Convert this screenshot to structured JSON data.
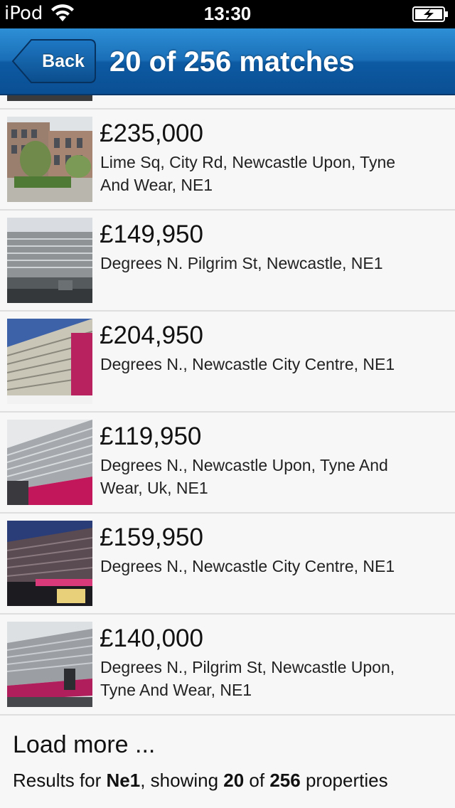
{
  "status_bar": {
    "carrier": "iPod",
    "time": "13:30"
  },
  "nav": {
    "back_label": "Back",
    "title": "20 of 256 matches"
  },
  "listings": [
    {
      "price": "£235,000",
      "address": "Lime Sq, City Rd, Newcastle Upon, Tyne And Wear, NE1",
      "photo": "brick-office-with-trees"
    },
    {
      "price": "£149,950",
      "address": "Degrees N. Pilgrim St, Newcastle, NE1",
      "photo": "grey-concrete-block"
    },
    {
      "price": "£204,950",
      "address": "Degrees N., Newcastle City Centre, NE1",
      "photo": "concrete-block-blue-sky"
    },
    {
      "price": "£119,950",
      "address": "Degrees N., Newcastle Upon, Tyne And Wear, Uk, NE1",
      "photo": "concrete-block-pink-facade"
    },
    {
      "price": "£159,950",
      "address": "Degrees N., Newcastle City Centre, NE1",
      "photo": "concrete-block-at-dusk"
    },
    {
      "price": "£140,000",
      "address": "Degrees N., Pilgrim St, Newcastle Upon, Tyne And Wear, NE1",
      "photo": "concrete-block-pink-facade-2"
    }
  ],
  "footer": {
    "load_more": "Load more ...",
    "results_prefix": "Results for ",
    "query": "Ne1",
    "results_middle": ", showing ",
    "shown": "20",
    "results_of": " of ",
    "total": "256",
    "results_suffix": " properties"
  },
  "colors": {
    "nav_blue": "#1a6fb8",
    "background": "#f7f7f7"
  }
}
